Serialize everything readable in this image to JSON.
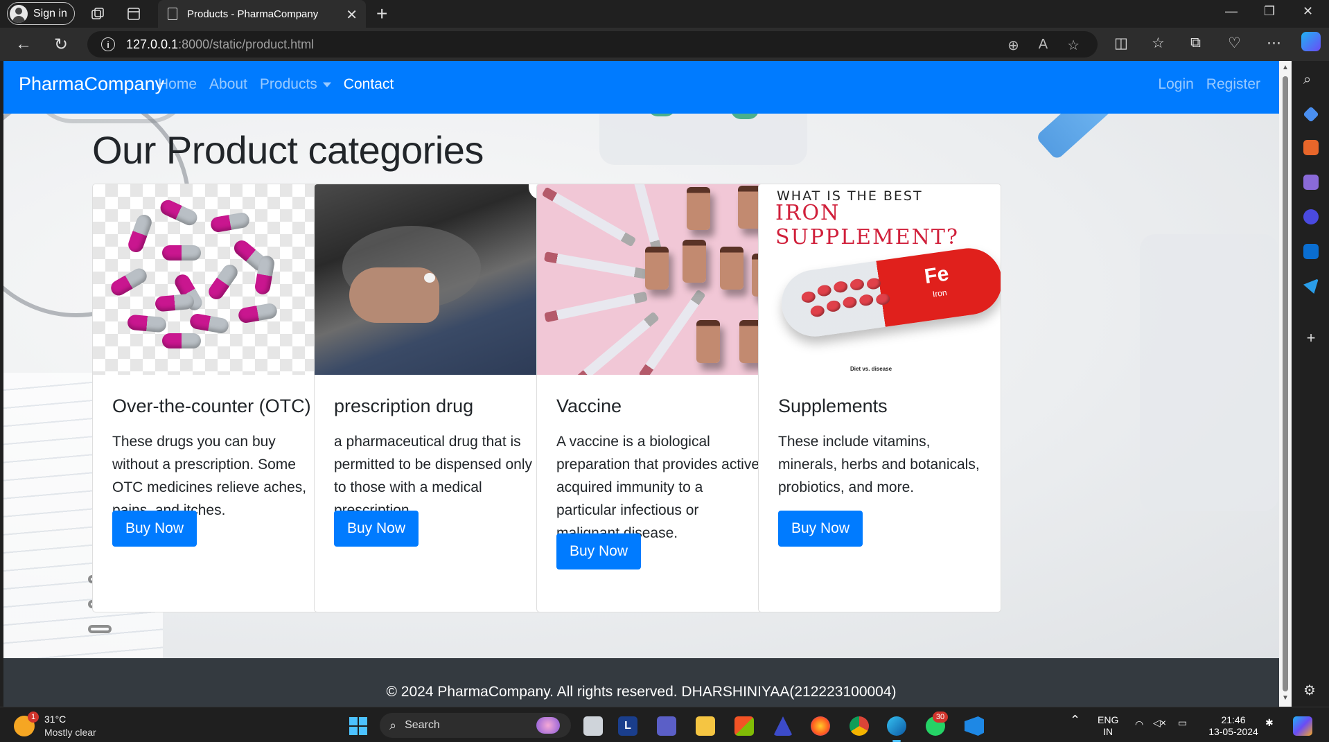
{
  "browser": {
    "signin_label": "Sign in",
    "tab_title": "Products - PharmaCompany",
    "url_host": "127.0.0.1",
    "url_path": ":8000/static/product.html"
  },
  "nav": {
    "brand": "PharmaCompany",
    "links": [
      "Home",
      "About",
      "Products",
      "Contact"
    ],
    "login": "Login",
    "register": "Register"
  },
  "page": {
    "heading": "Our Product categories"
  },
  "cards": [
    {
      "title": "Over-the-counter (OTC)",
      "text": "These drugs you can buy without a prescription. Some OTC medicines relieve aches, pains, and itches.",
      "button": "Buy Now"
    },
    {
      "title": "prescription drug",
      "text": "a pharmaceutical drug that is permitted to be dispensed only to those with a medical prescription.",
      "button": "Buy Now"
    },
    {
      "title": "Vaccine",
      "text": "A vaccine is a biological preparation that provides active acquired immunity to a particular infectious or malignant disease.",
      "button": "Buy Now"
    },
    {
      "title": "Supplements",
      "text": "These include vitamins, minerals, herbs and botanicals, probiotics, and more.",
      "button": "Buy Now",
      "image_text": {
        "line1": "WHAT IS THE BEST",
        "line2": "IRON SUPPLEMENT?",
        "pill_symbol": "Fe",
        "pill_label": "Iron",
        "brand": "Diet vs. disease"
      }
    }
  ],
  "footer": {
    "text": "© 2024 PharmaCompany. All rights reserved. DHARSHINIYAA(212223100004)"
  },
  "taskbar": {
    "weather_badge": "1",
    "temperature": "31°C",
    "weather_desc": "Mostly clear",
    "search_label": "Search",
    "whatsapp_badge": "30",
    "lang1": "ENG",
    "lang2": "IN",
    "time": "21:46",
    "date": "13-05-2024"
  },
  "colors": {
    "primary": "#007bff",
    "footer": "#343a40",
    "chrome": "#202020"
  }
}
